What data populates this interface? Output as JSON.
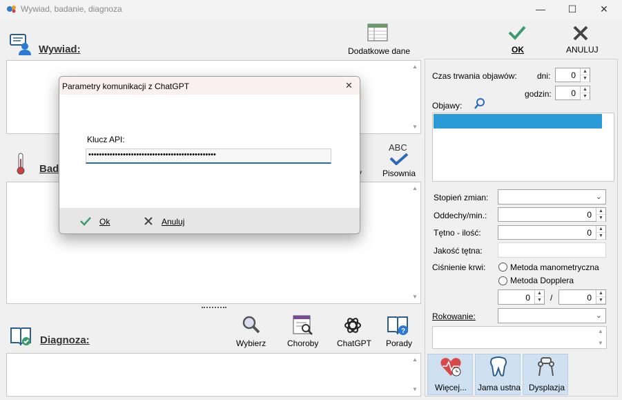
{
  "window": {
    "title": "Wywiad, badanie, diagnoza",
    "minimize": "—",
    "maximize": "☐",
    "close": "✕"
  },
  "toolbar": {
    "ok_label": "OK",
    "cancel_label": "ANULUJ",
    "extra_data_label": "Dodatkowe dane"
  },
  "sections": {
    "interview_title": "Wywiad:",
    "exam_title_partial": "Bad",
    "diagnosis_title": "Diagnoza:",
    "spelling_label": "Pisownia",
    "spelling_icon_text": "ABC",
    "partial_hidden_char": "y"
  },
  "diagnosis_tools": {
    "select": "Wybierz",
    "diseases": "Choroby",
    "chatgpt": "ChatGPT",
    "advice": "Porady"
  },
  "right_panel": {
    "duration_label": "Czas trwania objawów:",
    "days_label": "dni:",
    "days_value": "0",
    "hours_label": "godzin:",
    "hours_value": "0",
    "symptoms_label": "Objawy:",
    "change_degree_label": "Stopień zmian:",
    "breaths_label": "Oddechy/min.:",
    "breaths_value": "0",
    "pulse_count_label": "Tętno - ilość:",
    "pulse_count_value": "0",
    "pulse_quality_label": "Jakość tętna:",
    "blood_pressure_label": "Ciśnienie krwi:",
    "method_manometric": "Metoda manometryczna",
    "method_doppler": "Metoda Dopplera",
    "bp_systolic": "0",
    "bp_separator": "/",
    "bp_diastolic": "0",
    "prognosis_label": "Rokowanie:",
    "more_button": "Więcej...",
    "oral_button": "Jama ustna",
    "dysplasia_button": "Dysplazja"
  },
  "dialog": {
    "title": "Parametry komunikacji z ChatGPT",
    "close": "✕",
    "api_key_label": "Klucz API:",
    "api_key_value": "••••••••••••••••••••••••••••••••••••••••••••••••",
    "ok_label": "Ok",
    "cancel_label": "Anuluj"
  },
  "colors": {
    "accent_blue": "#2a9ad8",
    "ok_green": "#3c9a6e",
    "side_button_bg": "#cfe0f0"
  }
}
